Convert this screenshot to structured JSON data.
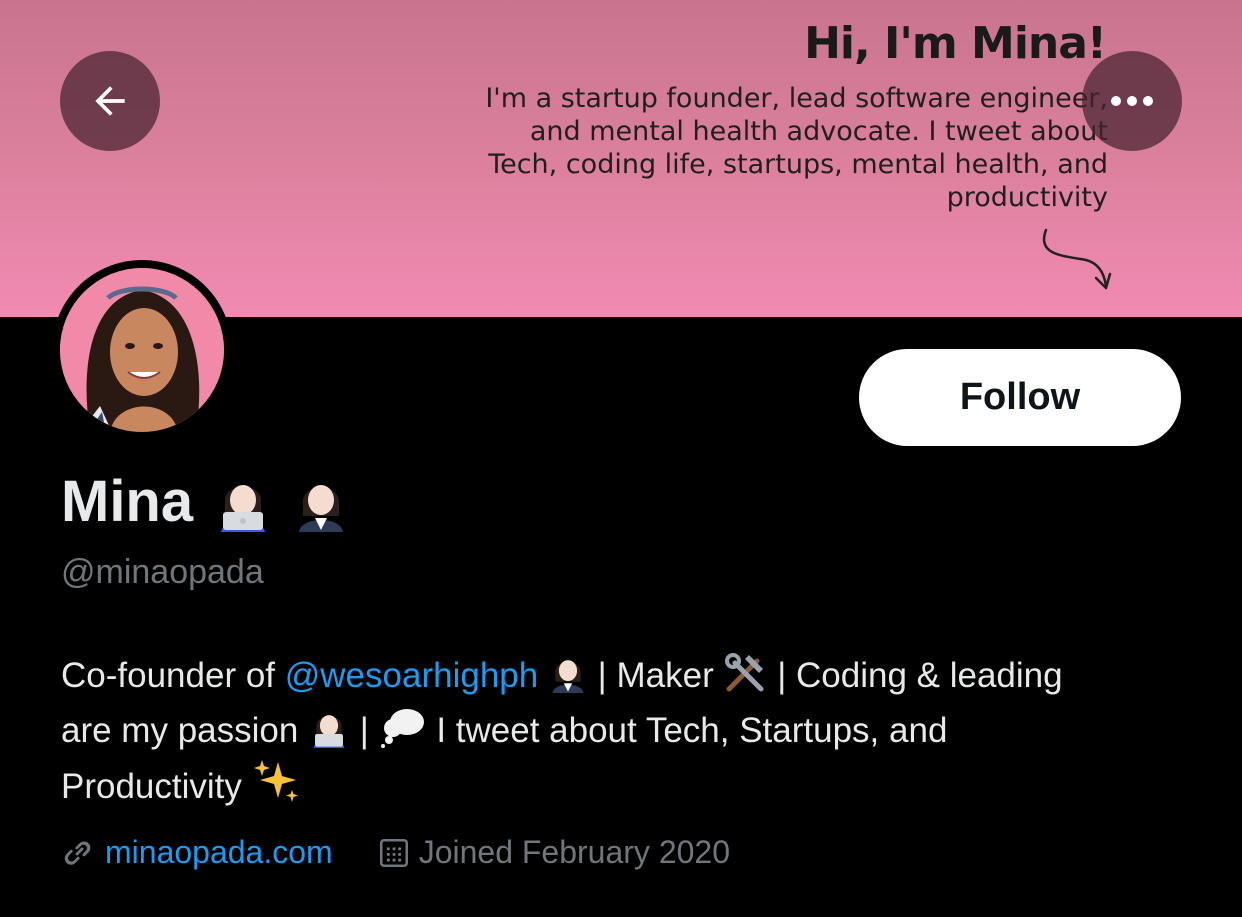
{
  "banner": {
    "title": "Hi, I'm Mina!",
    "text": "I'm a startup founder, lead software engineer, and mental health advocate. I tweet about Tech, coding life, startups, mental health, and productivity"
  },
  "header": {
    "back_icon": "arrow-left-icon",
    "more_icon": "more-horizontal-icon"
  },
  "profile": {
    "name": "Mina",
    "name_emojis": [
      "technologist-emoji",
      "office-worker-emoji"
    ],
    "handle": "@minaopada",
    "follow_label": "Follow",
    "bio": {
      "part1": "Co-founder of ",
      "mention": "@wesoarhighph",
      "part2": " | Maker ",
      "part3": " | Coding & leading",
      "part4": "are my passion ",
      "part5": " | ",
      "part6": " I tweet about Tech, Startups, and",
      "part7": "Productivity "
    },
    "website": "minaopada.com",
    "joined": "Joined February 2020"
  },
  "colors": {
    "background": "#000000",
    "banner_top": "#c9748f",
    "banner_bottom": "#f28ab2",
    "link": "#1d9bf0",
    "primary_text": "#e7e9ea",
    "secondary_text": "#71767b",
    "follow_bg": "#ffffff"
  }
}
